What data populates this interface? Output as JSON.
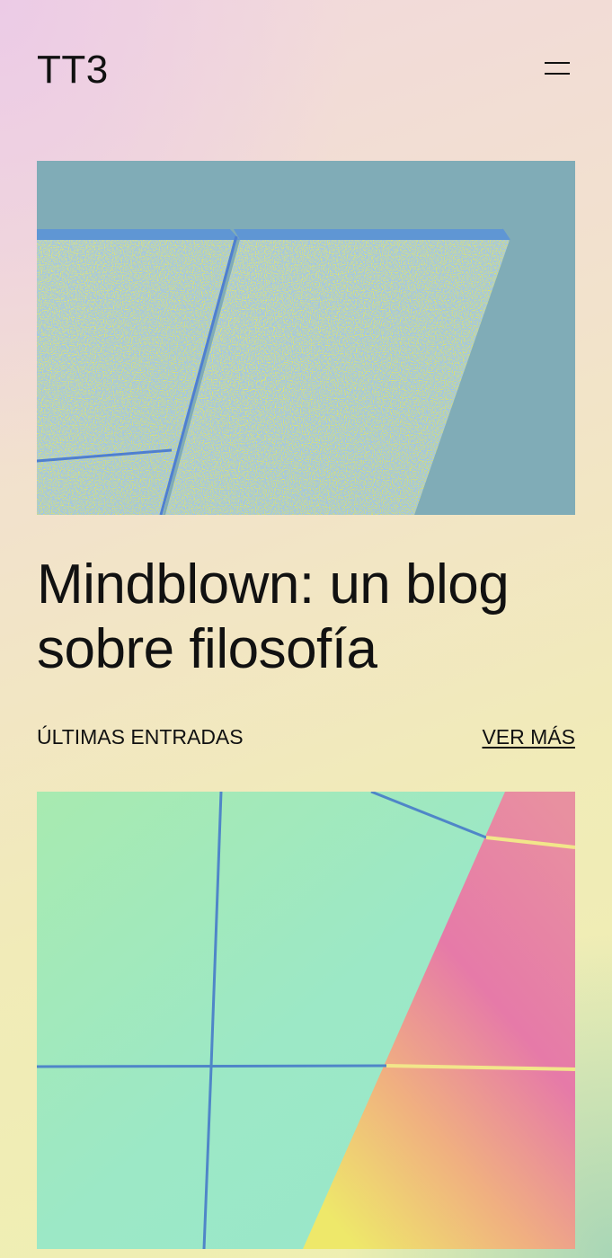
{
  "site": {
    "title": "TT3"
  },
  "menu": {
    "icon": "hamburger-menu-icon"
  },
  "hero": {
    "title": "Mindblown: un blog sobre filosofía",
    "image_subject": "yellow angled wall against blue sky"
  },
  "latest": {
    "section_label": "ÚLTIMAS ENTRADAS",
    "see_more_label": "VER MÁS"
  },
  "post": {
    "image_subject": "mint green tiled wall with pink gradient section"
  },
  "colors": {
    "text": "#111111",
    "hero_sky": "#7fadb8",
    "hero_wall": "#dfe56a",
    "hero_edge": "#5a8fd0",
    "post_mint": "#9ce8c6",
    "post_pink": "#e67aa8"
  }
}
